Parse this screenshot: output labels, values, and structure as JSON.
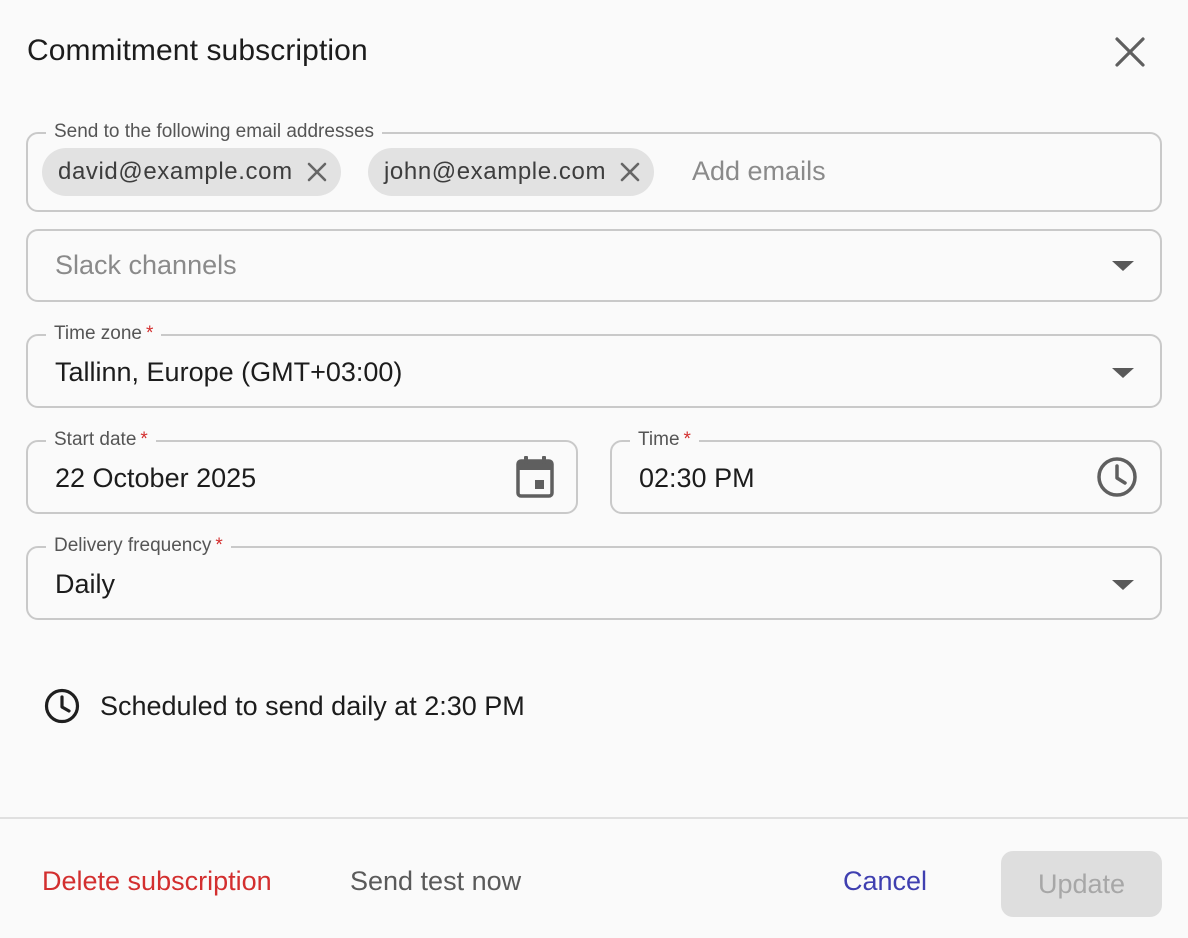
{
  "dialog": {
    "title": "Commitment subscription"
  },
  "emails": {
    "label": "Send to the following email addresses",
    "chips": [
      "david@example.com",
      "john@example.com"
    ],
    "placeholder": "Add emails"
  },
  "slack": {
    "placeholder": "Slack channels"
  },
  "timezone": {
    "label": "Time zone",
    "required_mark": "*",
    "value": "Tallinn, Europe (GMT+03:00)"
  },
  "start_date": {
    "label": "Start date",
    "required_mark": "*",
    "value": "22 October 2025"
  },
  "time": {
    "label": "Time",
    "required_mark": "*",
    "value": "02:30 PM"
  },
  "frequency": {
    "label": "Delivery frequency",
    "required_mark": "*",
    "value": "Daily"
  },
  "schedule": {
    "text": "Scheduled to send daily at 2:30 PM"
  },
  "footer": {
    "delete_label": "Delete subscription",
    "send_test_label": "Send test now",
    "cancel_label": "Cancel",
    "update_label": "Update"
  },
  "colors": {
    "danger": "#d32f2f",
    "primary": "#3f3fb0",
    "disabled_bg": "#dedede",
    "disabled_text": "#a7a7a7"
  },
  "icons": {
    "close": "close-icon",
    "chip_remove": "close-icon",
    "dropdown": "arrow-drop-down-icon",
    "calendar": "calendar-icon",
    "clock": "clock-icon"
  }
}
